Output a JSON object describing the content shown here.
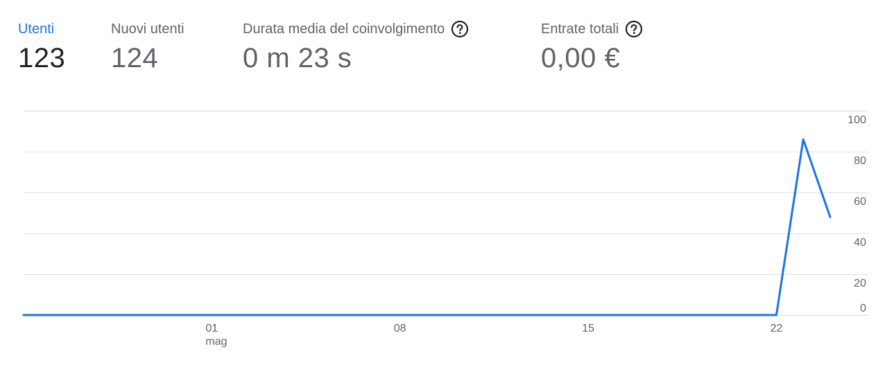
{
  "metrics": [
    {
      "id": "users",
      "label": "Utenti",
      "value": "123",
      "active": true,
      "has_help": false
    },
    {
      "id": "new_users",
      "label": "Nuovi utenti",
      "value": "124",
      "active": false,
      "has_help": false
    },
    {
      "id": "engagement",
      "label": "Durata media del coinvolgimento",
      "value": "0 m 23 s",
      "active": false,
      "has_help": true
    },
    {
      "id": "revenue",
      "label": "Entrate totali",
      "value": "0,00 €",
      "active": false,
      "has_help": true
    }
  ],
  "colors": {
    "accent": "#1a73e8",
    "line": "#1a73e8",
    "grid": "#e0e0e0",
    "text_muted": "#5f6368",
    "text_active": "#202124"
  },
  "icons": {
    "help": "help-circle-icon"
  },
  "chart_data": {
    "type": "line",
    "series": [
      {
        "x": [
          "2024-04-24",
          "2024-04-25",
          "2024-04-26",
          "2024-04-27",
          "2024-04-28",
          "2024-04-29",
          "2024-04-30",
          "2024-05-01",
          "2024-05-02",
          "2024-05-03",
          "2024-05-04",
          "2024-05-05",
          "2024-05-06",
          "2024-05-07",
          "2024-05-08",
          "2024-05-09",
          "2024-05-10",
          "2024-05-11",
          "2024-05-12",
          "2024-05-13",
          "2024-05-14",
          "2024-05-15",
          "2024-05-16",
          "2024-05-17",
          "2024-05-18",
          "2024-05-19",
          "2024-05-20",
          "2024-05-21",
          "2024-05-22",
          "2024-05-23",
          "2024-05-24"
        ],
        "values": [
          0,
          0,
          0,
          0,
          0,
          0,
          0,
          0,
          0,
          0,
          0,
          0,
          0,
          0,
          0,
          0,
          0,
          0,
          0,
          0,
          0,
          0,
          0,
          0,
          0,
          0,
          0,
          0,
          0,
          86,
          48
        ]
      }
    ],
    "x_ticks": [
      {
        "date": "2024-05-01",
        "label": "01",
        "sublabel": "mag"
      },
      {
        "date": "2024-05-08",
        "label": "08",
        "sublabel": ""
      },
      {
        "date": "2024-05-15",
        "label": "15",
        "sublabel": ""
      },
      {
        "date": "2024-05-22",
        "label": "22",
        "sublabel": ""
      }
    ],
    "y_ticks": [
      0,
      20,
      40,
      60,
      80,
      100
    ],
    "ylim": [
      0,
      100
    ],
    "grid": true,
    "y_axis_position": "right"
  }
}
